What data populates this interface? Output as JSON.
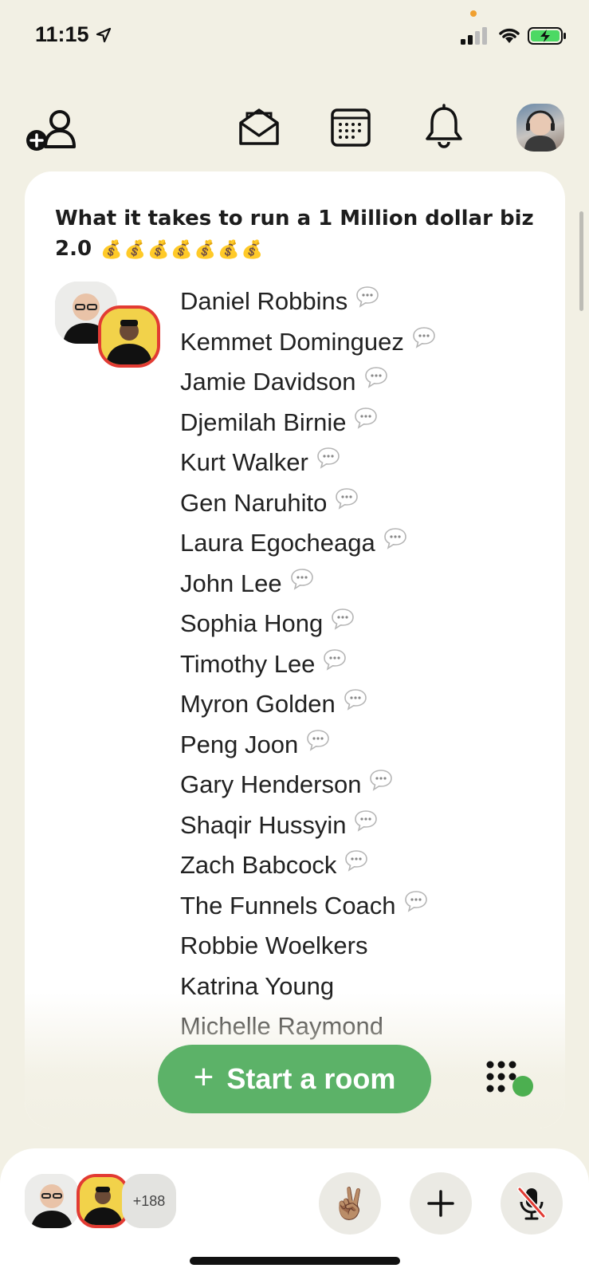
{
  "status_bar": {
    "time": "11:15"
  },
  "room": {
    "title": "What it takes to run a 1 Million dollar biz 2.0",
    "title_emoji": [
      "💰",
      "💰",
      "💰",
      "💰",
      "💰",
      "💰",
      "💰"
    ],
    "participants": [
      {
        "name": "Daniel Robbins",
        "chat": true
      },
      {
        "name": "Kemmet Dominguez",
        "chat": true
      },
      {
        "name": "Jamie Davidson",
        "chat": true
      },
      {
        "name": "Djemilah Birnie",
        "chat": true
      },
      {
        "name": "Kurt Walker",
        "chat": true
      },
      {
        "name": "Gen Naruhito",
        "chat": true
      },
      {
        "name": "Laura Egocheaga",
        "chat": true
      },
      {
        "name": "John Lee",
        "chat": true
      },
      {
        "name": "Sophia Hong",
        "chat": true
      },
      {
        "name": "Timothy Lee",
        "chat": true
      },
      {
        "name": "Myron Golden",
        "chat": true
      },
      {
        "name": "Peng Joon",
        "chat": true
      },
      {
        "name": "Gary Henderson",
        "chat": true
      },
      {
        "name": "Shaqir Hussyin",
        "chat": true
      },
      {
        "name": "Zach Babcock",
        "chat": true
      },
      {
        "name": "The Funnels Coach",
        "chat": true
      },
      {
        "name": "Robbie Woelkers",
        "chat": false
      },
      {
        "name": "Katrina Young",
        "chat": false
      },
      {
        "name": "Michelle Raymond",
        "chat": false
      }
    ]
  },
  "start_room": {
    "plus": "+",
    "label": "Start a room"
  },
  "bottom_bar": {
    "count_label": "+188",
    "hand_emoji": "✌🏽",
    "plus": "+"
  },
  "colors": {
    "background": "#f2f0e4",
    "accent_green": "#5cb268",
    "speaker_ring": "#e23b33"
  },
  "icons": [
    "location-arrow-icon",
    "signal-icon",
    "wifi-icon",
    "battery-icon",
    "add-user-icon",
    "envelope-icon",
    "calendar-icon",
    "bell-icon",
    "chat-bubble-icon",
    "dots-grid-icon",
    "mic-muted-icon",
    "plus-icon"
  ]
}
